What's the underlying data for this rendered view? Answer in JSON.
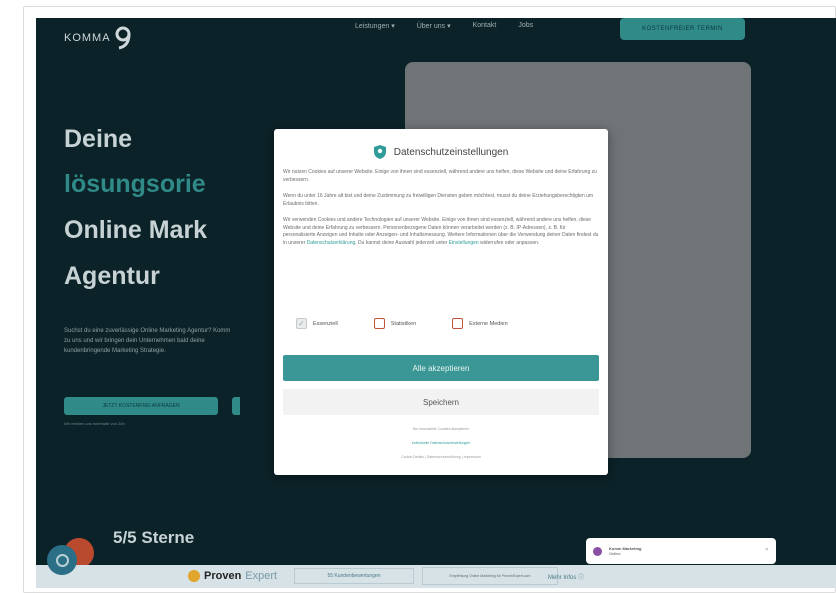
{
  "header": {
    "logo_text": "KOMMA",
    "nav": [
      "Leistungen ▾",
      "Über uns ▾",
      "Kontakt",
      "Jobs"
    ],
    "cta": "KOSTENFREIER TERMIN"
  },
  "hero": {
    "line1": "Deine",
    "line2": "lösungsorie",
    "line3": "Online Mark",
    "line4": "Agentur",
    "subtext": "Suchst du eine zuverlässige Online Marketing Agentur? Komm zu uns und wir bringen dein Unternehmen bald deine kundenbringende Marketing Strategie.",
    "button": "JETZT KOSTENFREI ANFRAGEN",
    "note": "Wir melden uns innerhalb von 24h"
  },
  "stars_text": "5/5 Sterne",
  "consent": {
    "title": "Datenschutzeinstellungen",
    "p1": "Wir nutzen Cookies auf unserer Website. Einige von ihnen sind essenziell, während andere uns helfen, diese Website und deine Erfahrung zu verbessern.",
    "p2": "Wenn du unter 16 Jahre alt bist und deine Zustimmung zu freiwilligen Diensten geben möchtest, musst du deine Erziehungsberechtigten um Erlaubnis bitten.",
    "p3": "Wir verwenden Cookies und andere Technologien auf unserer Website. Einige von ihnen sind essenziell, während andere uns helfen, diese Website und deine Erfahrung zu verbessern. Personenbezogene Daten können verarbeitet werden (z. B. IP-Adressen), z. B. für personalisierte Anzeigen und Inhalte oder Anzeigen- und Inhaltsmessung. Weitere Informationen über die Verwendung deiner Daten findest du in unserer",
    "p3_link": "Datenschutzerklärung",
    "p3_end": ". Du kannst deine Auswahl jederzeit unter",
    "p3_link2": "Einstellungen",
    "p3_end2": "widerrufen oder anpassen.",
    "options": [
      {
        "label": "Essenziell",
        "checked": true
      },
      {
        "label": "Statistiken",
        "checked": false
      },
      {
        "label": "Externe Medien",
        "checked": false
      }
    ],
    "accept_all": "Alle akzeptieren",
    "save": "Speichern",
    "only_essential": "Nur essenzielle Cookies akzeptieren",
    "individual": "Individuelle Datenschutzeinstellungen",
    "footer_links": "Cookie-Details | Datenschutzerklärung | Impressum"
  },
  "chat_notification": {
    "name": "Komm Marketing",
    "text": "Online"
  },
  "proven_expert": {
    "brand_a": "Proven",
    "brand_b": "Expert",
    "count": "55 Kundenbewertungen",
    "desc": "Empfehlung Online Marketing für ProvenExpert.com",
    "more": "Mehr Infos ⓘ"
  },
  "colors": {
    "site_bg": "#0b2228",
    "accent": "#2f8a88",
    "button_teal": "#3a9795"
  }
}
